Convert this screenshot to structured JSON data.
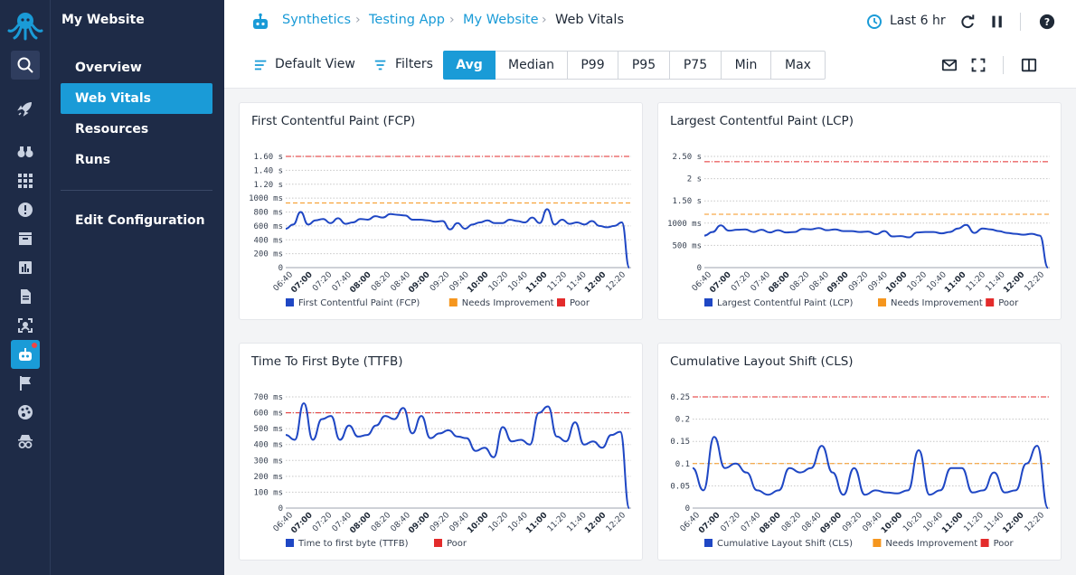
{
  "site": {
    "title": "My Website"
  },
  "nav": {
    "items": [
      {
        "label": "Overview",
        "active": false
      },
      {
        "label": "Web Vitals",
        "active": true
      },
      {
        "label": "Resources",
        "active": false
      },
      {
        "label": "Runs",
        "active": false
      }
    ],
    "edit_configuration": "Edit Configuration"
  },
  "rail_icons": [
    "octopus-logo-icon",
    "search-icon",
    "rocket-icon",
    "binoculars-icon",
    "grid-icon",
    "alert-icon",
    "inbox-icon",
    "bar-chart-icon",
    "document-icon",
    "scan-icon",
    "robot-icon",
    "flag-icon",
    "palette-icon",
    "spy-icon"
  ],
  "breadcrumb": [
    "Synthetics",
    "Testing App",
    "My Website",
    "Web Vitals"
  ],
  "time_range": "Last 6 hr",
  "toolbar": {
    "default_view": "Default View",
    "filters": "Filters",
    "aggregations": [
      "Avg",
      "Median",
      "P99",
      "P95",
      "P75",
      "Min",
      "Max"
    ],
    "active_aggregation": "Avg"
  },
  "colors": {
    "accent": "#1a9bd7",
    "series": "#1f47c4",
    "needs_improvement": "#f5961e",
    "poor": "#e32b2b",
    "sidebar": "#1e2b47"
  },
  "chart_data": [
    {
      "type": "line",
      "title": "First Contentful Paint (FCP)",
      "x": [
        "06:40",
        "07:00",
        "07:20",
        "07:40",
        "08:00",
        "08:20",
        "08:40",
        "09:00",
        "09:20",
        "09:40",
        "10:00",
        "10:20",
        "10:40",
        "11:00",
        "11:20",
        "11:40",
        "12:00",
        "12:20"
      ],
      "x_bold": [
        "07:00",
        "08:00",
        "09:00",
        "10:00",
        "11:00",
        "12:00"
      ],
      "y_ticks": [
        "0",
        "200 ms",
        "400 ms",
        "600 ms",
        "800 ms",
        "1000 ms",
        "1.20 s",
        "1.40 s",
        "1.60 s"
      ],
      "ylim": [
        0,
        1600
      ],
      "thresholds": {
        "needs_improvement": 930,
        "poor": 1600
      },
      "series": [
        {
          "name": "First Contentful Paint (FCP)",
          "values": [
            560,
            620,
            800,
            620,
            680,
            700,
            640,
            710,
            630,
            650,
            700,
            690,
            740,
            720,
            770,
            760,
            750,
            690,
            690,
            680,
            660,
            670,
            550,
            640,
            560,
            620,
            650,
            680,
            640,
            640,
            690,
            670,
            650,
            720,
            640,
            840,
            620,
            690,
            630,
            650,
            620,
            670,
            600,
            580,
            600,
            650,
            0
          ]
        }
      ],
      "legend": [
        "First Contentful Paint (FCP)",
        "Needs Improvement",
        "Poor"
      ]
    },
    {
      "type": "line",
      "title": "Largest Contentful Paint (LCP)",
      "x": [
        "06:40",
        "07:00",
        "07:20",
        "07:40",
        "08:00",
        "08:20",
        "08:40",
        "09:00",
        "09:20",
        "09:40",
        "10:00",
        "10:20",
        "10:40",
        "11:00",
        "11:20",
        "11:40",
        "12:00",
        "12:20"
      ],
      "x_bold": [
        "07:00",
        "08:00",
        "09:00",
        "10:00",
        "11:00",
        "12:00"
      ],
      "y_ticks": [
        "0",
        "500 ms",
        "1000 ms",
        "1.50 s",
        "2 s",
        "2.50 s"
      ],
      "ylim": [
        0,
        2500
      ],
      "thresholds": {
        "needs_improvement": 1200,
        "poor": 2380
      },
      "series": [
        {
          "name": "Largest Contentful Paint (LCP)",
          "values": [
            720,
            800,
            950,
            830,
            850,
            860,
            800,
            850,
            790,
            840,
            790,
            800,
            870,
            860,
            890,
            840,
            860,
            820,
            820,
            800,
            810,
            750,
            820,
            700,
            710,
            680,
            790,
            800,
            800,
            770,
            800,
            880,
            960,
            780,
            880,
            860,
            820,
            780,
            760,
            740,
            760,
            720,
            0
          ]
        }
      ],
      "legend": [
        "Largest Contentful Paint (LCP)",
        "Needs Improvement",
        "Poor"
      ]
    },
    {
      "type": "line",
      "title": "Time To First Byte (TTFB)",
      "x": [
        "06:40",
        "07:00",
        "07:20",
        "07:40",
        "08:00",
        "08:20",
        "08:40",
        "09:00",
        "09:20",
        "09:40",
        "10:00",
        "10:20",
        "10:40",
        "11:00",
        "11:20",
        "11:40",
        "12:00",
        "12:20"
      ],
      "x_bold": [
        "07:00",
        "08:00",
        "09:00",
        "10:00",
        "11:00",
        "12:00"
      ],
      "y_ticks": [
        "0",
        "100 ms",
        "200 ms",
        "300 ms",
        "400 ms",
        "500 ms",
        "600 ms",
        "700 ms"
      ],
      "ylim": [
        0,
        700
      ],
      "thresholds": {
        "poor": 600
      },
      "series": [
        {
          "name": "Time to first byte (TTFB)",
          "values": [
            460,
            430,
            660,
            430,
            560,
            580,
            430,
            520,
            450,
            460,
            520,
            580,
            560,
            630,
            470,
            580,
            440,
            470,
            490,
            450,
            440,
            360,
            380,
            320,
            510,
            420,
            430,
            400,
            600,
            640,
            450,
            420,
            540,
            400,
            420,
            380,
            460,
            480,
            0
          ]
        }
      ],
      "legend": [
        "Time to first byte (TTFB)",
        "Poor"
      ]
    },
    {
      "type": "line",
      "title": "Cumulative Layout Shift (CLS)",
      "x": [
        "06:40",
        "07:00",
        "07:20",
        "07:40",
        "08:00",
        "08:20",
        "08:40",
        "09:00",
        "09:20",
        "09:40",
        "10:00",
        "10:20",
        "10:40",
        "11:00",
        "11:20",
        "11:40",
        "12:00",
        "12:20"
      ],
      "x_bold": [
        "07:00",
        "08:00",
        "09:00",
        "10:00",
        "11:00",
        "12:00"
      ],
      "y_ticks": [
        "0",
        "0.05",
        "0.1",
        "0.15",
        "0.2",
        "0.25"
      ],
      "ylim": [
        0,
        0.25
      ],
      "thresholds": {
        "needs_improvement": 0.1,
        "poor": 0.25
      },
      "series": [
        {
          "name": "Cumulative Layout Shift (CLS)",
          "values": [
            0.09,
            0.04,
            0.16,
            0.09,
            0.1,
            0.08,
            0.04,
            0.03,
            0.04,
            0.09,
            0.08,
            0.09,
            0.14,
            0.08,
            0.03,
            0.09,
            0.03,
            0.04,
            0.035,
            0.033,
            0.04,
            0.13,
            0.03,
            0.04,
            0.09,
            0.09,
            0.035,
            0.04,
            0.08,
            0.035,
            0.04,
            0.1,
            0.14,
            0
          ]
        }
      ],
      "legend": [
        "Cumulative Layout Shift (CLS)",
        "Needs Improvement",
        "Poor"
      ]
    }
  ]
}
